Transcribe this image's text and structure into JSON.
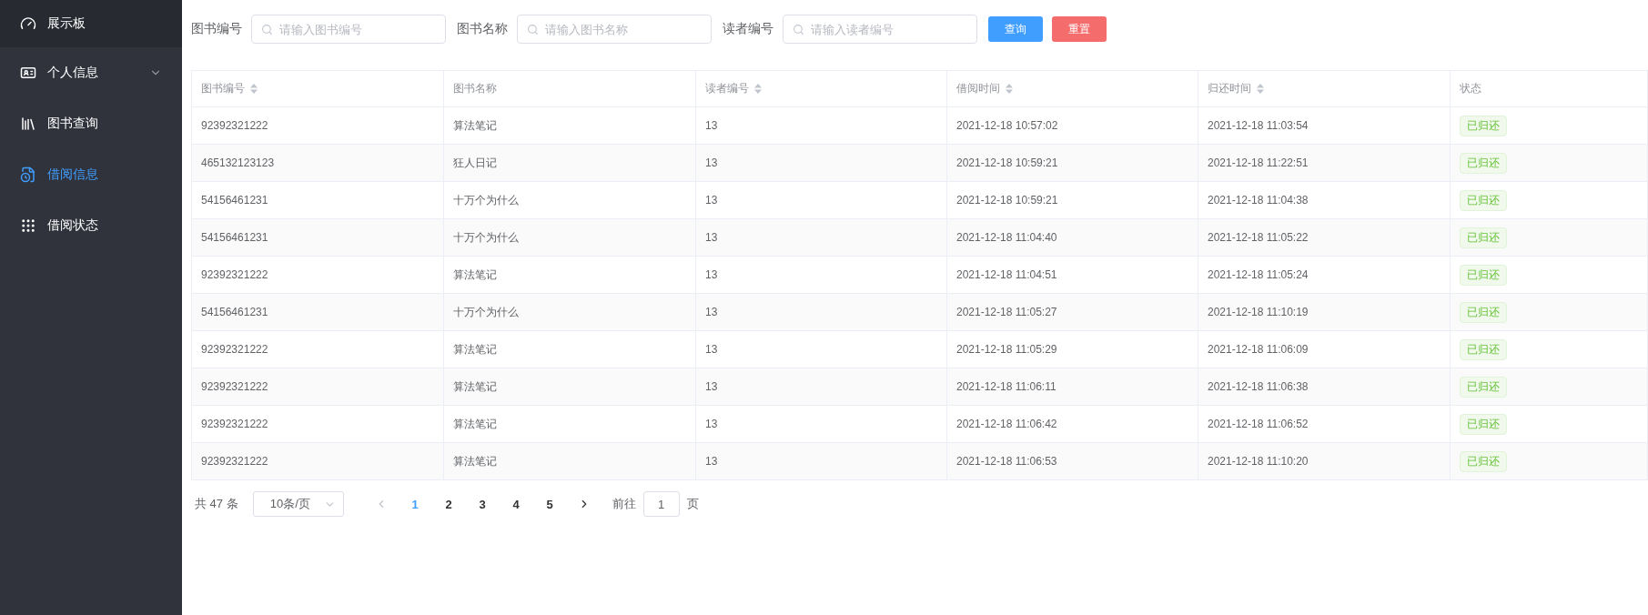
{
  "sidebar": {
    "items": [
      {
        "label": "展示板",
        "selected": false
      },
      {
        "label": "个人信息",
        "selected": false,
        "expanded": false
      },
      {
        "label": "图书查询",
        "selected": false
      },
      {
        "label": "借阅信息",
        "selected": true
      },
      {
        "label": "借阅状态",
        "selected": false
      }
    ]
  },
  "filters": [
    {
      "label": "图书编号",
      "placeholder": "请输入图书编号"
    },
    {
      "label": "图书名称",
      "placeholder": "请输入图书名称"
    },
    {
      "label": "读者编号",
      "placeholder": "请输入读者编号"
    }
  ],
  "buttons": [
    {
      "label": "查询",
      "kind": "primary"
    },
    {
      "label": "重置",
      "kind": "danger"
    }
  ],
  "table": {
    "columns": [
      {
        "label": "图书编号",
        "sortable": true
      },
      {
        "label": "图书名称",
        "sortable": false
      },
      {
        "label": "读者编号",
        "sortable": true
      },
      {
        "label": "借阅时间",
        "sortable": true
      },
      {
        "label": "归还时间",
        "sortable": true
      },
      {
        "label": "状态",
        "sortable": false
      }
    ],
    "rows": [
      [
        "92392321222",
        "算法笔记",
        "13",
        "2021-12-18 10:57:02",
        "2021-12-18 11:03:54",
        "已归还"
      ],
      [
        "465132123123",
        "狂人日记",
        "13",
        "2021-12-18 10:59:21",
        "2021-12-18 11:22:51",
        "已归还"
      ],
      [
        "54156461231",
        "十万个为什么",
        "13",
        "2021-12-18 10:59:21",
        "2021-12-18 11:04:38",
        "已归还"
      ],
      [
        "54156461231",
        "十万个为什么",
        "13",
        "2021-12-18 11:04:40",
        "2021-12-18 11:05:22",
        "已归还"
      ],
      [
        "92392321222",
        "算法笔记",
        "13",
        "2021-12-18 11:04:51",
        "2021-12-18 11:05:24",
        "已归还"
      ],
      [
        "54156461231",
        "十万个为什么",
        "13",
        "2021-12-18 11:05:27",
        "2021-12-18 11:10:19",
        "已归还"
      ],
      [
        "92392321222",
        "算法笔记",
        "13",
        "2021-12-18 11:05:29",
        "2021-12-18 11:06:09",
        "已归还"
      ],
      [
        "92392321222",
        "算法笔记",
        "13",
        "2021-12-18 11:06:11",
        "2021-12-18 11:06:38",
        "已归还"
      ],
      [
        "92392321222",
        "算法笔记",
        "13",
        "2021-12-18 11:06:42",
        "2021-12-18 11:06:52",
        "已归还"
      ],
      [
        "92392321222",
        "算法笔记",
        "13",
        "2021-12-18 11:06:53",
        "2021-12-18 11:10:20",
        "已归还"
      ]
    ]
  },
  "pagination": {
    "total": "共 47 条",
    "page_size": "10条/页",
    "pages": [
      {
        "label": "1",
        "selected": true
      },
      {
        "label": "2",
        "selected": false
      },
      {
        "label": "3",
        "selected": false
      },
      {
        "label": "4",
        "selected": false
      },
      {
        "label": "5",
        "selected": false
      }
    ],
    "goto_label": "前往",
    "goto_value": "1",
    "goto_suffix": "页"
  }
}
